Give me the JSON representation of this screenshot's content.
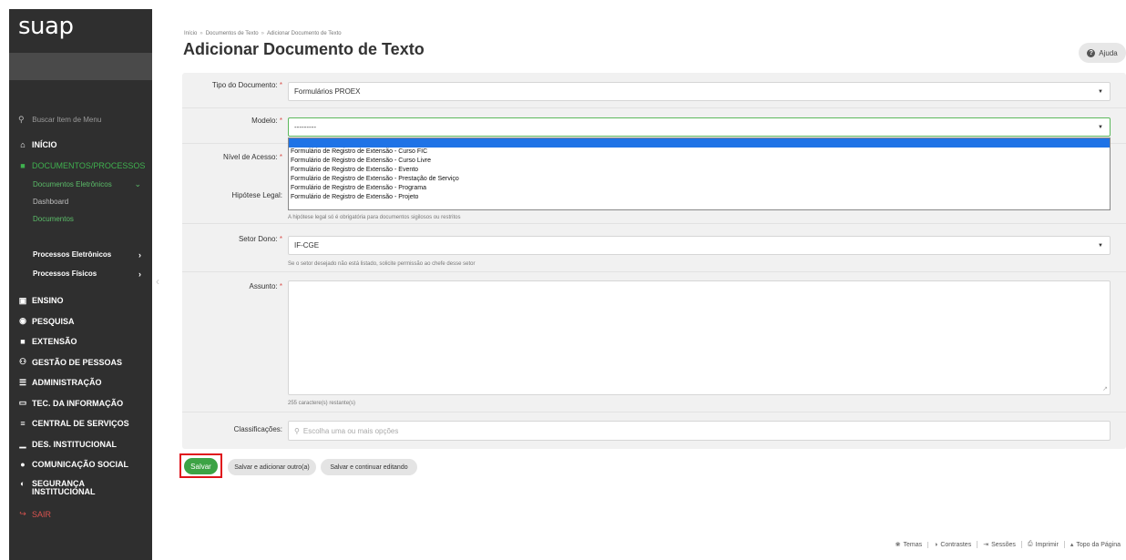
{
  "sidebar": {
    "logo": "suap",
    "search_placeholder": "Buscar Item de Menu",
    "items": {
      "inicio": "INÍCIO",
      "documentos": "DOCUMENTOS/PROCESSOS",
      "documentos_eletronicos": "Documentos Eletrônicos",
      "dashboard": "Dashboard",
      "documentos_sub": "Documentos",
      "processos_eletronicos": "Processos Eletrônicos",
      "processos_fisicos": "Processos Físicos",
      "ensino": "ENSINO",
      "pesquisa": "PESQUISA",
      "extensao": "EXTENSÃO",
      "gestao_pessoas": "GESTÃO DE PESSOAS",
      "administracao": "ADMINISTRAÇÃO",
      "tec_informacao": "TEC. DA INFORMAÇÃO",
      "central_servicos": "CENTRAL DE SERVIÇOS",
      "des_institucional": "DES. INSTITUCIONAL",
      "comunicacao_social": "COMUNICAÇÃO SOCIAL",
      "seguranca_1": "SEGURANÇA",
      "seguranca_2": "INSTITUCIONAL",
      "sair": "SAIR"
    }
  },
  "header": {
    "breadcrumb": [
      "Início",
      "Documentos de Texto",
      "Adicionar Documento de Texto"
    ],
    "title": "Adicionar Documento de Texto",
    "help_label": "Ajuda"
  },
  "form": {
    "tipo_label": "Tipo do Documento:",
    "tipo_value": "Formulários PROEX",
    "modelo_label": "Modelo:",
    "modelo_value": "---------",
    "nivel_label": "Nível de Acesso:",
    "hipotese_label": "Hipótese Legal:",
    "hipotese_help": "A hipótese legal só é obrigatória para documentos sigilosos ou restritos",
    "setor_label": "Setor Dono:",
    "setor_value": "IF-CGE",
    "setor_help": "Se o setor desejado não está listado, solicite permissão ao chefe desse setor",
    "assunto_label": "Assunto:",
    "assunto_counter": "255 caractere(s) restante(s)",
    "classificacoes_label": "Classificações:",
    "classificacoes_placeholder": "Escolha uma ou mais opções",
    "required_mark": "*"
  },
  "dropdown": {
    "options": [
      "---------",
      "Formulário de Registro de Extensão - Curso FIC",
      "Formulário de Registro de Extensão - Curso Livre",
      "Formulário de Registro de Extensão - Evento",
      "Formulário de Registro de Extensão - Prestação de Serviço",
      "Formulário de Registro de Extensão - Programa",
      "Formulário de Registro de Extensão - Projeto"
    ]
  },
  "buttons": {
    "salvar": "Salvar",
    "salvar_adicionar": "Salvar e adicionar outro(a)",
    "salvar_continuar": "Salvar e continuar editando"
  },
  "footer": {
    "temas": "Temas",
    "contrastes": "Contrastes",
    "sessoes": "Sessões",
    "imprimir": "Imprimir",
    "topo": "Topo da Página"
  },
  "colors": {
    "sidebar_bg": "#2f2f2f",
    "accent_green": "#3ca345",
    "highlight_red": "#e0141c",
    "selection_blue": "#1f73e6"
  }
}
